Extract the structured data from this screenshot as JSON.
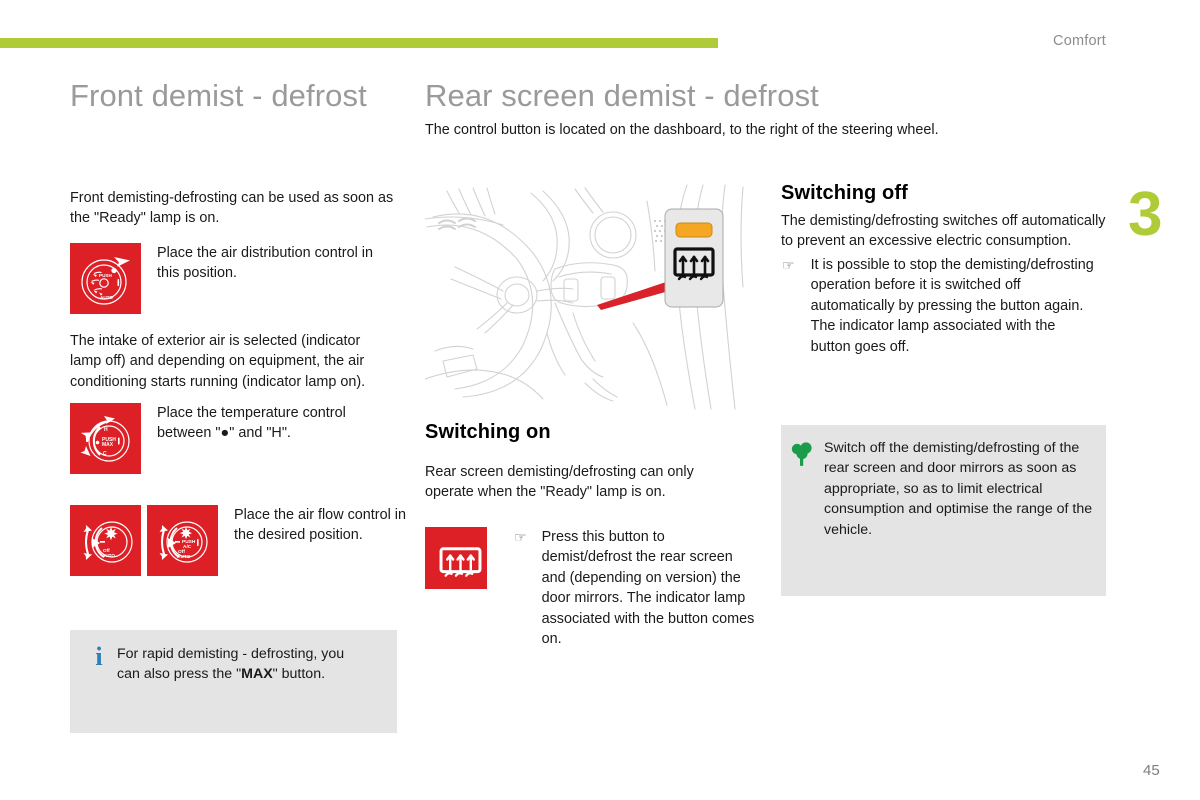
{
  "header": {
    "chapter_label": "Comfort",
    "chapter_number": "3",
    "page_number": "45",
    "accent_color": "#afcb37"
  },
  "left_column": {
    "title": "Front demist - defrost",
    "lead_paragraph": "Front demisting-defrosting can be used as soon as the \"Ready\" lamp is on.",
    "steps": [
      {
        "icon": "air-distribution-dial-icon",
        "text": "Place the air distribution control in this position."
      },
      {
        "icon": "temperature-dial-icon",
        "text": "Place the temperature control between \"●\" and \"H\"."
      },
      {
        "icon": "air-flow-dial-icon",
        "text": "Place the air flow control in the desired position."
      }
    ],
    "middle_paragraph": "The intake of exterior air is selected (indicator lamp off) and depending on equipment, the air conditioning starts running (indicator lamp on).",
    "info_box": {
      "icon": "info-icon",
      "text": "For rapid demisting - defrosting, you can also press the \"MAX\" button.",
      "bold_word": "MAX"
    }
  },
  "middle_column": {
    "title": "Rear screen demist - defrost",
    "subtitle": "The control button is located on the dashboard, to the right of the steering wheel.",
    "illustration": {
      "name": "dashboard-steering-wheel-illustration",
      "callout_button": "rear-screen-demist-button",
      "indicator_lamp_color": "#f5a623",
      "pointer_color": "#d8232a"
    },
    "switching_on": {
      "heading": "Switching on",
      "paragraph": "Rear screen demisting/defrosting can only operate when the \"Ready\" lamp is on.",
      "bullet_icon": "pointing-hand-icon",
      "bullet_text": "Press this button to demist/defrost the rear screen and (depending on version) the door mirrors. The indicator lamp associated with the button comes on.",
      "icon": "rear-demist-icon"
    }
  },
  "right_column": {
    "switching_off": {
      "heading": "Switching off",
      "paragraph": "The demisting/defrosting switches off automatically to prevent an excessive electric consumption.",
      "bullet_icon": "pointing-hand-icon",
      "bullet_text": "It is possible to stop the demisting/defrosting operation before it is switched off automatically by pressing the button again. The indicator lamp associated with the button goes off."
    },
    "eco_box": {
      "icon": "eco-tree-icon",
      "icon_color": "#1a9c4a",
      "text": "Switch off the demisting/defrosting of the rear screen and door mirrors as soon as appropriate, so as to limit electrical consumption and optimise the range of the vehicle."
    }
  }
}
